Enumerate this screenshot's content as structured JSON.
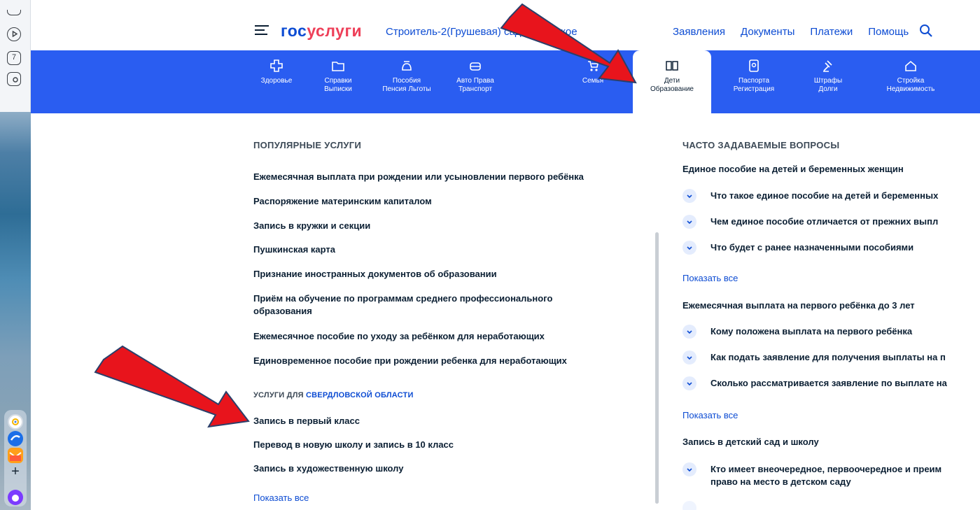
{
  "header": {
    "logo_part1": "гос",
    "logo_part2": "услуги",
    "location": "Строитель-2(Грушевая) садоводческое",
    "nav": [
      "Заявления",
      "Документы",
      "Платежи",
      "Помощь"
    ]
  },
  "categories": [
    {
      "line1": "Здоровье",
      "line2": "",
      "icon": "health-cross-icon"
    },
    {
      "line1": "Справки",
      "line2": "Выписки",
      "icon": "folder-icon"
    },
    {
      "line1": "Пособия",
      "line2": "Пенсия Льготы",
      "icon": "benefit-icon"
    },
    {
      "line1": "Авто Права",
      "line2": "Транспорт",
      "icon": "car-icon"
    },
    {
      "line1": "Семья",
      "line2": "",
      "icon": "stroller-icon"
    },
    {
      "line1": "Дети",
      "line2": "Образование",
      "icon": "book-icon"
    },
    {
      "line1": "Паспорта",
      "line2": "Регистрация",
      "icon": "passport-icon"
    },
    {
      "line1": "Штрафы",
      "line2": "Долги",
      "icon": "gavel-icon"
    },
    {
      "line1": "Стройка",
      "line2": "Недвижимость",
      "icon": "house-icon"
    }
  ],
  "popular": {
    "title": "ПОПУЛЯРНЫЕ УСЛУГИ",
    "items": [
      "Ежемесячная выплата при рождении или усыновлении первого ребёнка",
      "Распоряжение материнским капиталом",
      "Запись в кружки и секции",
      "Пушкинская карта",
      "Признание иностранных документов об образовании",
      "Приём на обучение по программам среднего профессионального образования",
      "Ежемесячное пособие по уходу за ребёнком для неработающих",
      "Единовременное пособие при рождении ребенка для неработающих"
    ]
  },
  "regional": {
    "title_prefix": "УСЛУГИ ДЛЯ ",
    "title_region": "СВЕРДЛОВСКОЙ ОБЛАСТИ",
    "items": [
      "Запись в первый класс",
      "Перевод в новую школу и запись в 10 класс",
      "Запись в художественную школу"
    ],
    "show_all": "Показать все"
  },
  "faq": {
    "title": "ЧАСТО ЗАДАВАЕМЫЕ ВОПРОСЫ",
    "groups": [
      {
        "title": "Единое пособие на детей и беременных женщин",
        "questions": [
          "Что такое единое пособие на детей и беременных",
          "Чем единое пособие отличается от прежних выпл",
          "Что будет с ранее назначенными пособиями"
        ],
        "show_all": "Показать все"
      },
      {
        "title": "Ежемесячная выплата на первого ребёнка до 3 лет",
        "questions": [
          "Кому положена выплата на первого ребёнка",
          "Как подать заявление для получения выплаты на п",
          "Сколько рассматривается заявление по выплате на"
        ],
        "show_all": "Показать все"
      },
      {
        "title": "Запись в детский сад и школу",
        "questions": [
          "Кто имеет внеочередное, первоочередное и преим",
          "право на место в детском саду"
        ]
      }
    ]
  },
  "sidebar": {
    "calendar_day": "7"
  },
  "colors": {
    "brand_blue": "#0d4cd3",
    "brand_red": "#ee3f58",
    "category_bar": "#2a5df1",
    "arrow": "#e8141c"
  }
}
